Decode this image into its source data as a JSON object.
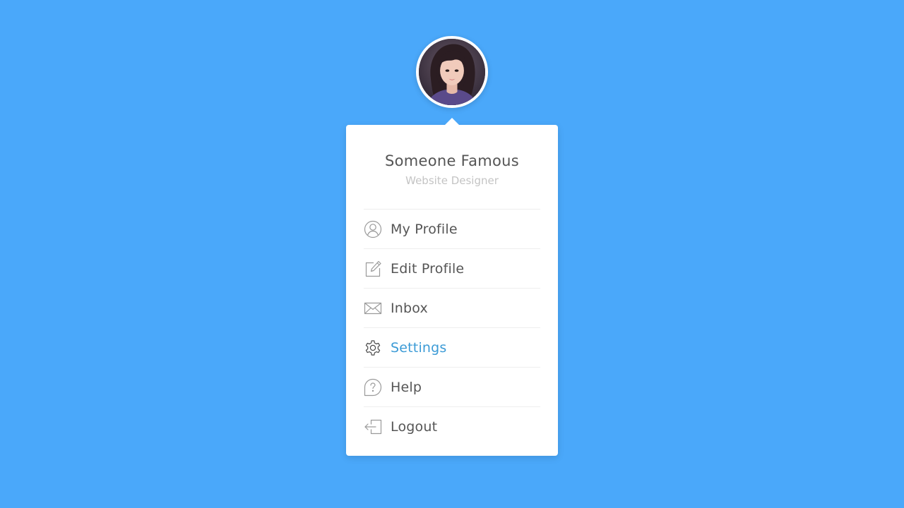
{
  "profile": {
    "name": "Someone Famous",
    "role": "Website Designer"
  },
  "menu": {
    "items": [
      {
        "label": "My Profile",
        "icon": "user-circle-icon"
      },
      {
        "label": "Edit Profile",
        "icon": "edit-icon"
      },
      {
        "label": "Inbox",
        "icon": "envelope-icon"
      },
      {
        "label": "Settings",
        "icon": "gear-icon",
        "active": true
      },
      {
        "label": "Help",
        "icon": "help-icon"
      },
      {
        "label": "Logout",
        "icon": "logout-icon"
      }
    ]
  },
  "colors": {
    "background": "#4aa8fa",
    "card": "#ffffff",
    "text": "#555555",
    "muted": "#c4c4c4",
    "active": "#3c9bd6",
    "icon": "#9a9a9a"
  }
}
